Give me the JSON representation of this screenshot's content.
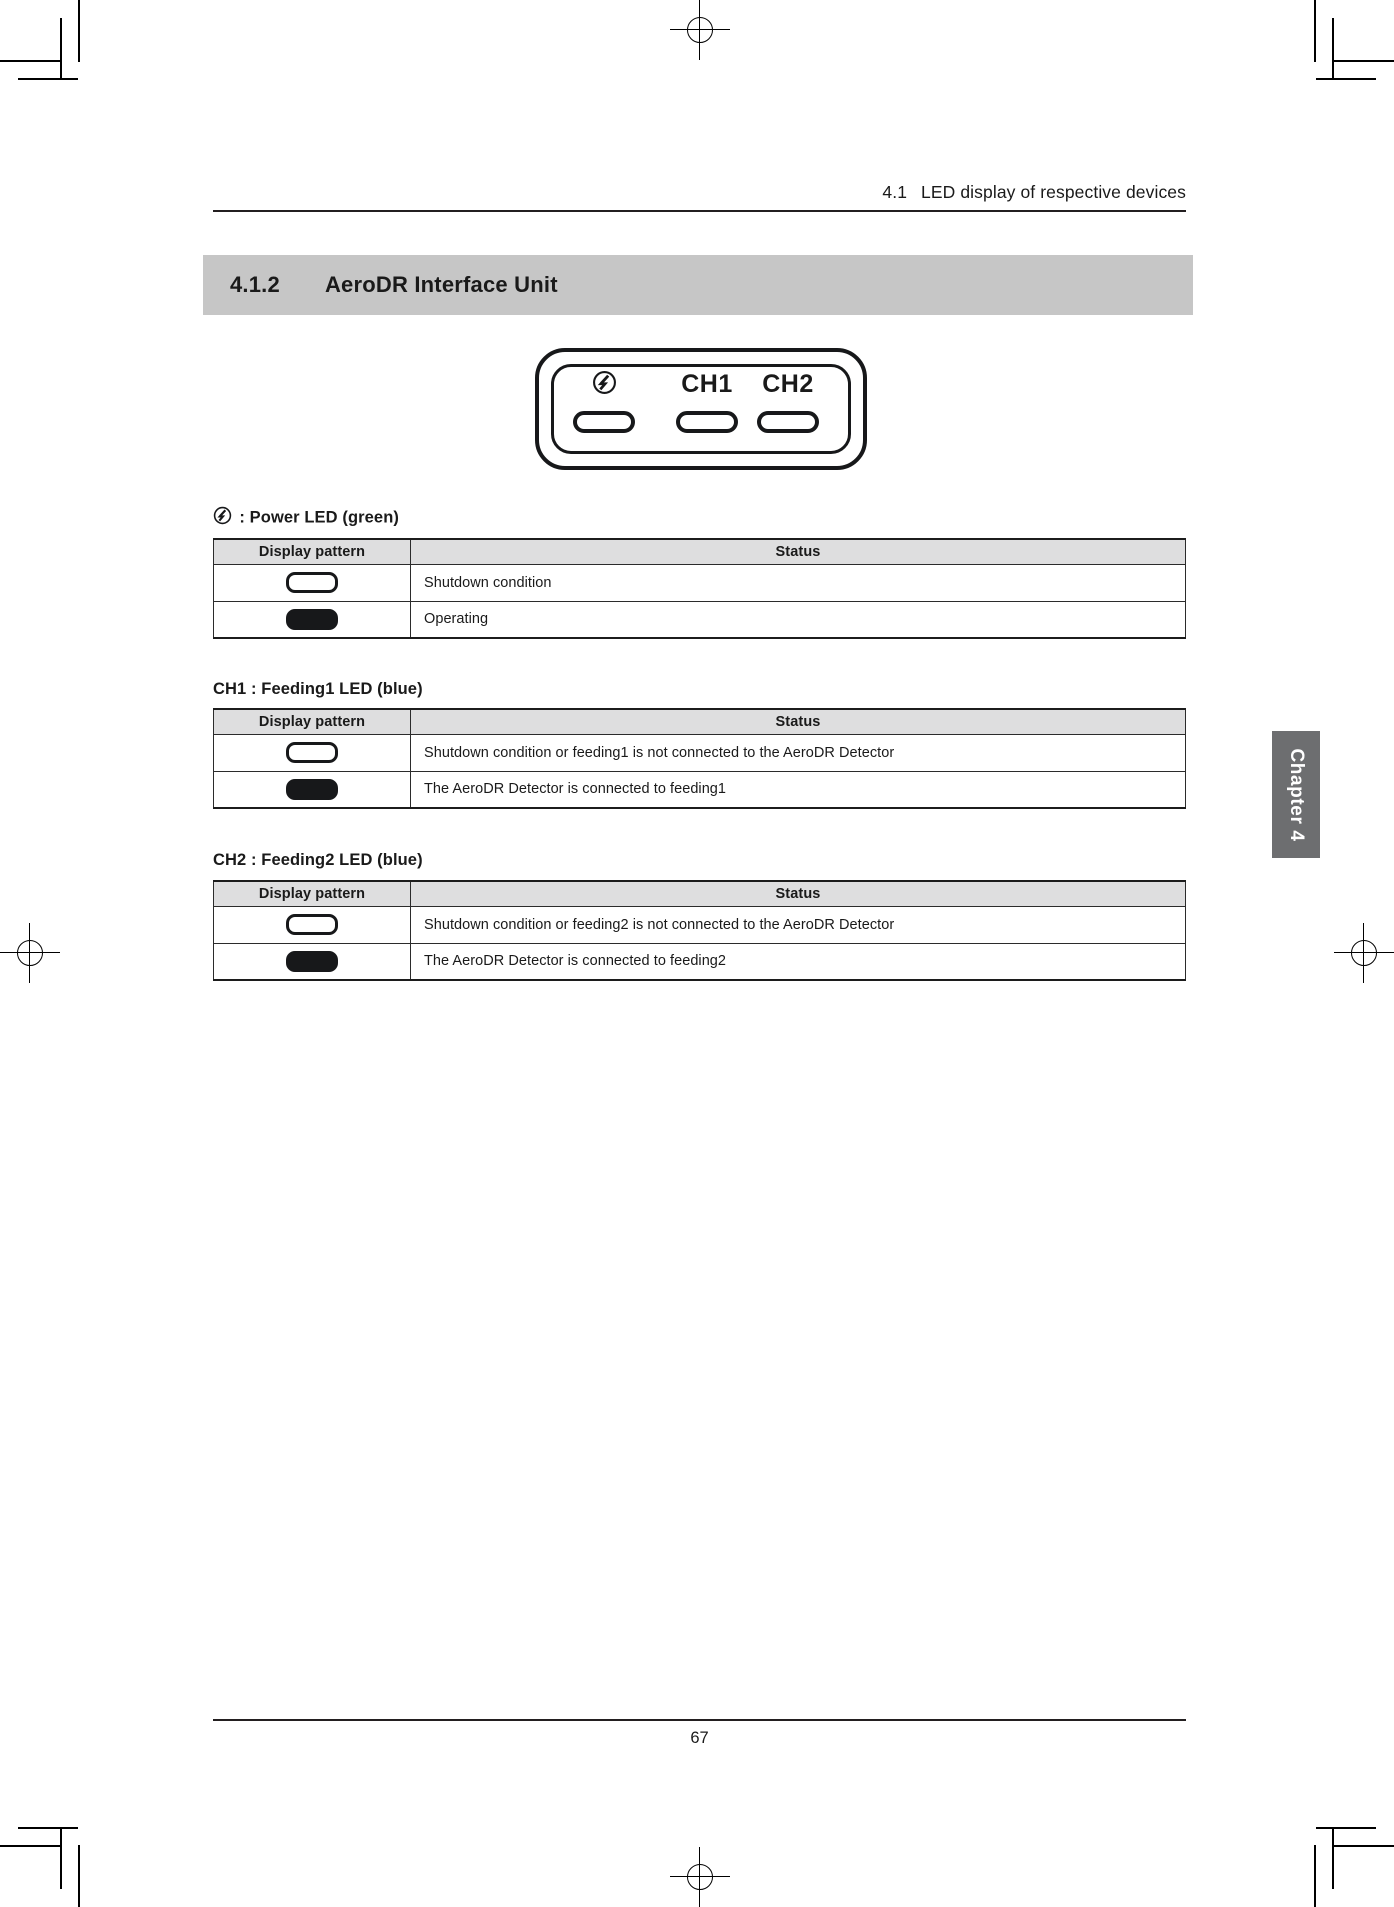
{
  "header": {
    "section_number": "4.1",
    "title": "LED display of respective devices"
  },
  "section": {
    "number": "4.1.2",
    "title": "AeroDR Interface Unit"
  },
  "device_illustration": {
    "power_icon": "power-led-icon",
    "label_ch1": "CH1",
    "label_ch2": "CH2",
    "slots": [
      "power-led-slot",
      "ch1-led-slot",
      "ch2-led-slot"
    ]
  },
  "columns": {
    "display_pattern": "Display pattern",
    "status": "Status"
  },
  "groups": [
    {
      "id": "power-led",
      "icon": "power-led-icon",
      "caption": ": Power LED (green)",
      "rows": [
        {
          "pattern": "off",
          "status": "Shutdown condition"
        },
        {
          "pattern": "on",
          "status": "Operating"
        }
      ]
    },
    {
      "id": "ch1-feeding1-led",
      "icon": null,
      "caption": "CH1 : Feeding1 LED (blue)",
      "rows": [
        {
          "pattern": "off",
          "status": "Shutdown condition or feeding1 is not connected to the AeroDR Detector"
        },
        {
          "pattern": "on",
          "status": "The AeroDR Detector is connected to feeding1"
        }
      ]
    },
    {
      "id": "ch2-feeding2-led",
      "icon": null,
      "caption": "CH2 : Feeding2 LED (blue)",
      "rows": [
        {
          "pattern": "off",
          "status": "Shutdown condition or feeding2 is not connected to the AeroDR Detector"
        },
        {
          "pattern": "on",
          "status": "The AeroDR Detector is connected to feeding2"
        }
      ]
    }
  ],
  "chapter_tab": {
    "label": "Chapter 4",
    "color": "#6d6e70"
  },
  "footer": {
    "page_number": "67"
  },
  "colors": {
    "section_band": "#c6c6c6",
    "table_header": "#dededf",
    "rule": "#231f20",
    "ink": "#17181a"
  }
}
